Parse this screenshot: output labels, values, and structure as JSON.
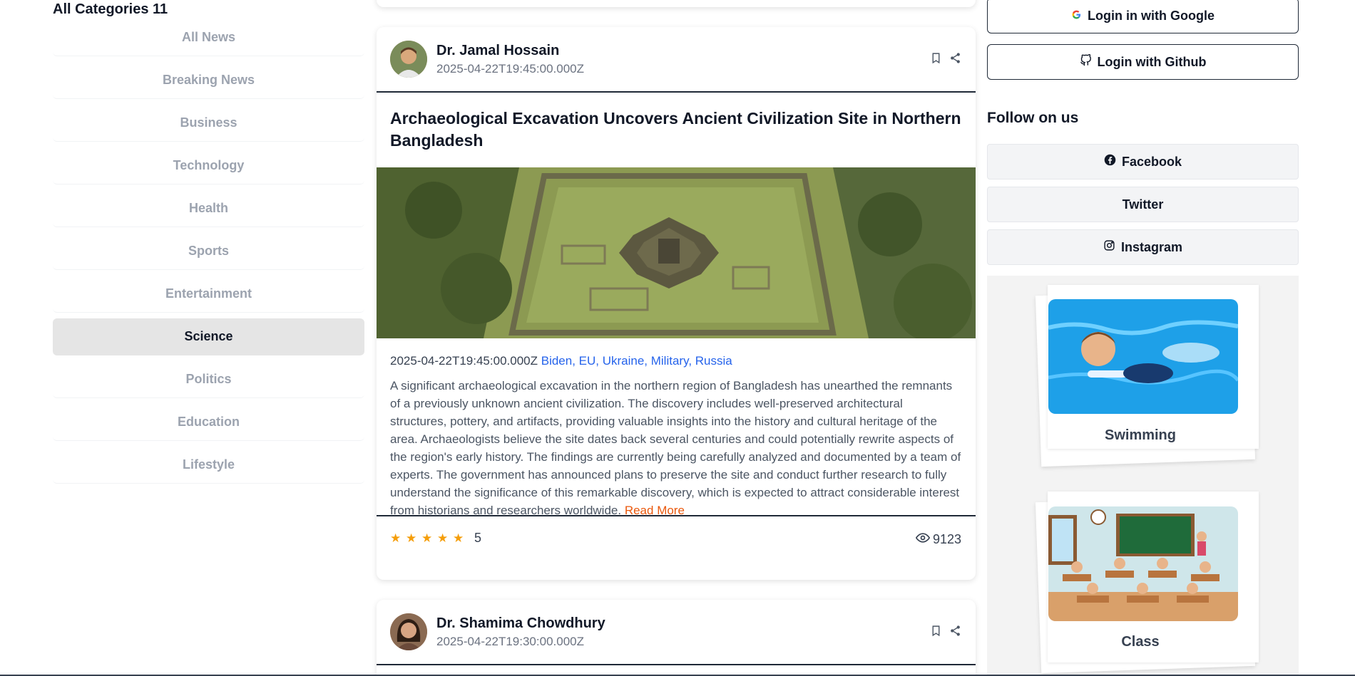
{
  "sidebar": {
    "title": "All Categories 11",
    "items": [
      {
        "label": "All News",
        "active": false
      },
      {
        "label": "Breaking News",
        "active": false
      },
      {
        "label": "Business",
        "active": false
      },
      {
        "label": "Technology",
        "active": false
      },
      {
        "label": "Health",
        "active": false
      },
      {
        "label": "Sports",
        "active": false
      },
      {
        "label": "Entertainment",
        "active": false
      },
      {
        "label": "Science",
        "active": true
      },
      {
        "label": "Politics",
        "active": false
      },
      {
        "label": "Education",
        "active": false
      },
      {
        "label": "Lifestyle",
        "active": false
      }
    ]
  },
  "feed": {
    "article": {
      "author": "Dr. Jamal Hossain",
      "date": "2025-04-22T19:45:00.000Z",
      "title": "Archaeological Excavation Uncovers Ancient Civilization Site in Northern Bangladesh",
      "meta_date": "2025-04-22T19:45:00.000Z",
      "tags": "Biden, EU, Ukraine, Military, Russia",
      "body": "A significant archaeological excavation in the northern region of Bangladesh has unearthed the remnants of a previously unknown ancient civilization. The discovery includes well-preserved architectural structures, pottery, and artifacts, providing valuable insights into the history and cultural heritage of the area. Archaeologists believe the site dates back several centuries and could potentially rewrite aspects of the region's early history. The findings are currently being carefully analyzed and documented by a team of experts. The government has announced plans to preserve the site and conduct further research to fully understand the significance of this remarkable discovery, which is expected to attract considerable interest from historians and researchers worldwide.",
      "read_more": "Read More",
      "rating_stars": 5,
      "rating_value": "5",
      "views": "9123"
    },
    "next_article": {
      "author": "Dr. Shamima Chowdhury",
      "date": "2025-04-22T19:30:00.000Z"
    }
  },
  "right": {
    "login_google": "Login in with Google",
    "login_github": "Login with Github",
    "follow_title": "Follow on us",
    "social": {
      "facebook": "Facebook",
      "twitter": "Twitter",
      "instagram": "Instagram"
    },
    "promos": [
      {
        "label": "Swimming"
      },
      {
        "label": "Class"
      }
    ]
  },
  "colors": {
    "accent_link": "#2563eb",
    "read_more": "#ea580c",
    "star": "#f59e0b",
    "active_category_bg": "#e5e5e5"
  },
  "icons": {
    "google": "google-icon",
    "github": "github-icon",
    "facebook": "facebook-icon",
    "instagram": "instagram-icon",
    "bookmark": "bookmark-icon",
    "share": "share-icon",
    "eye": "eye-icon",
    "star": "star-icon"
  }
}
